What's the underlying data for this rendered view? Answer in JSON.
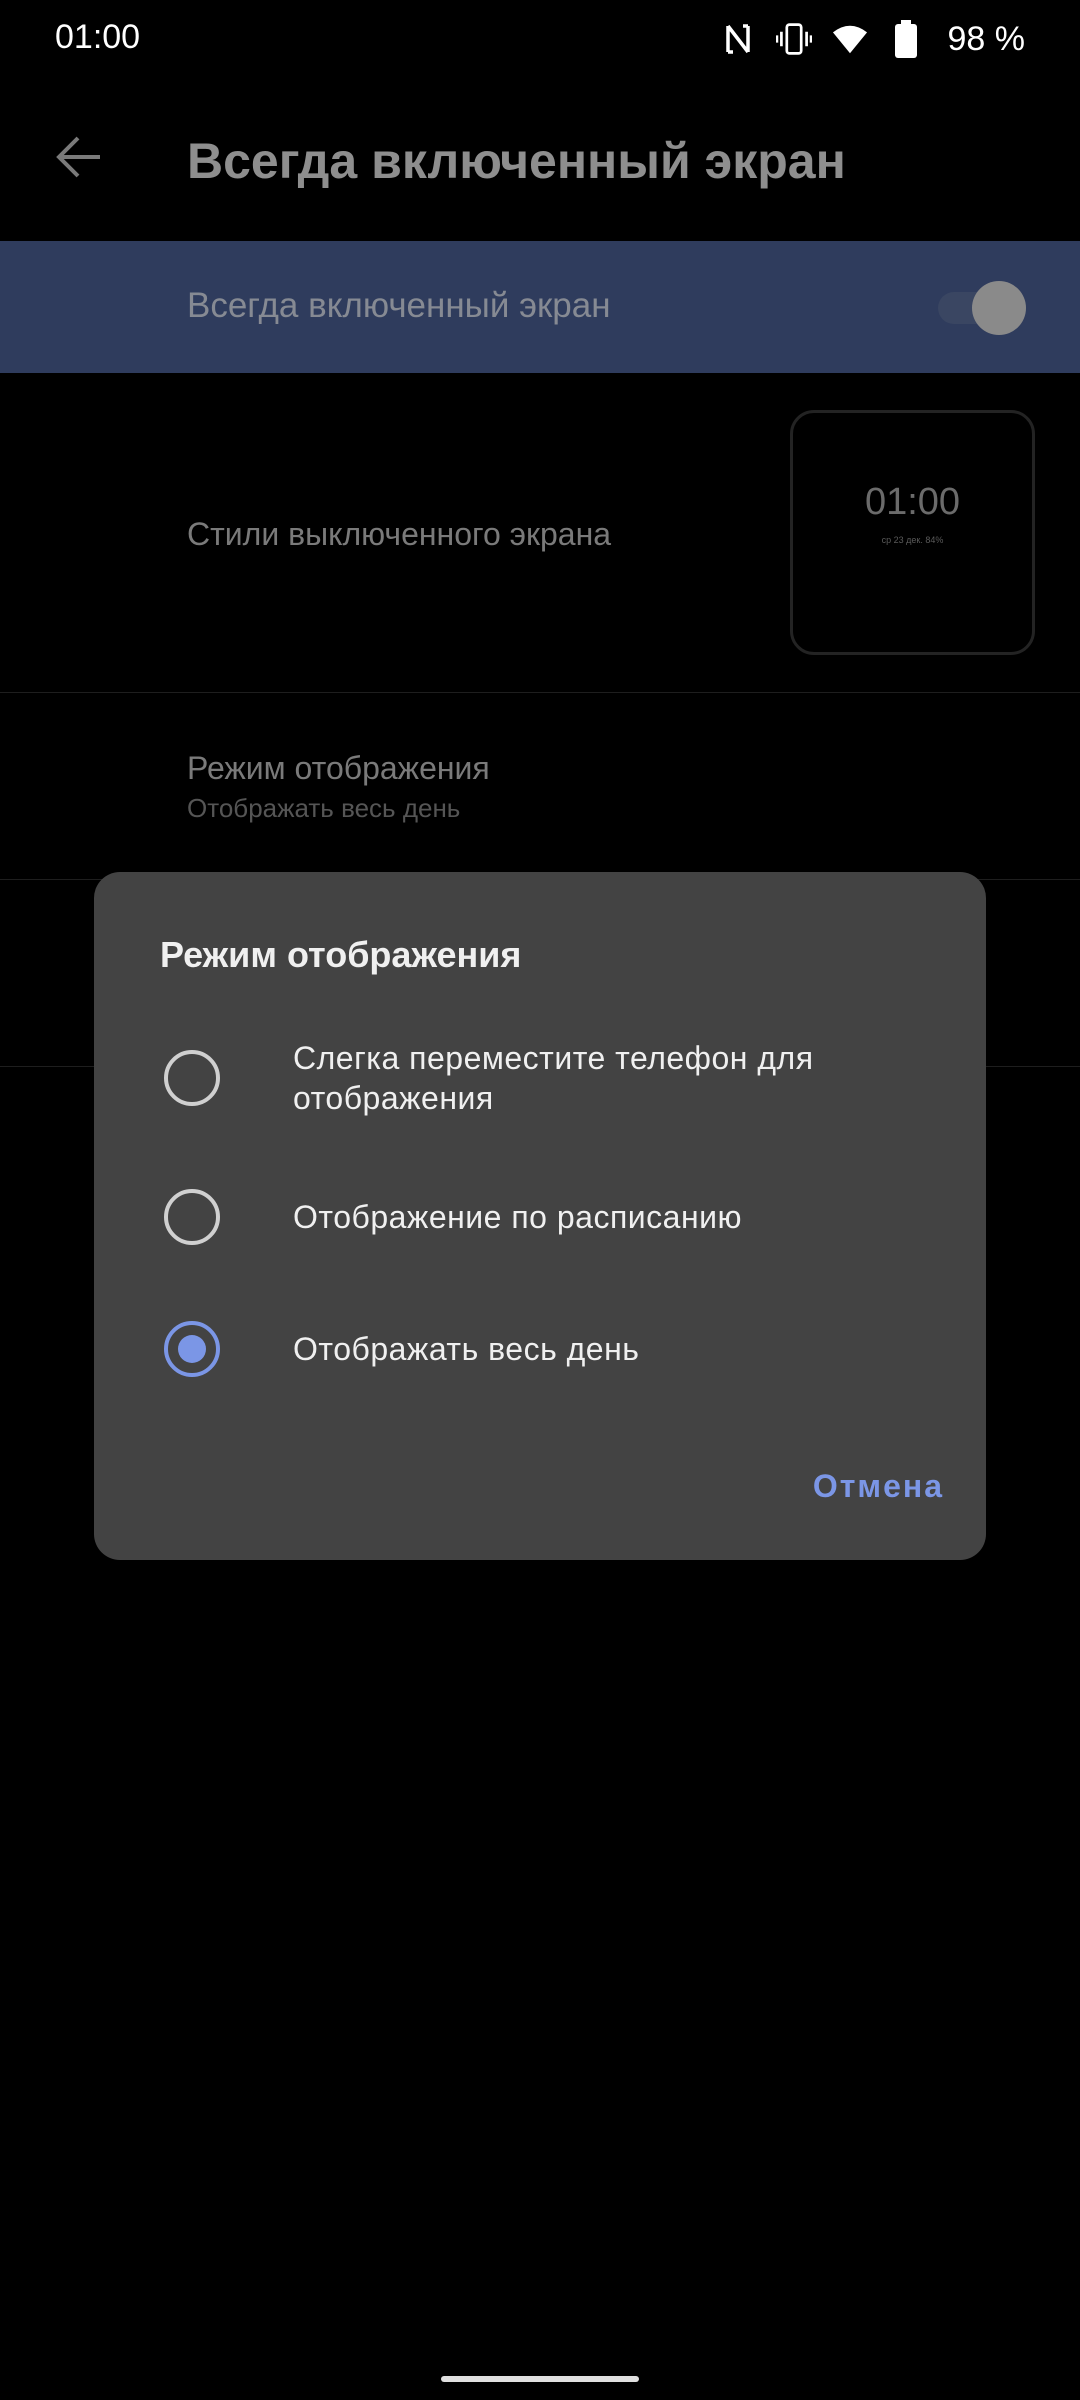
{
  "status_bar": {
    "time": "01:00",
    "battery_percent": "98 %",
    "icons": [
      "nfc-icon",
      "vibrate-icon",
      "wifi-icon",
      "battery-icon"
    ]
  },
  "header": {
    "title": "Всегда включенный экран",
    "back_icon": "arrow-back-icon"
  },
  "toggle_row": {
    "label": "Всегда включенный экран",
    "enabled": true
  },
  "styles_row": {
    "label": "Стили выключенного экрана",
    "preview_time": "01:00",
    "preview_date": "ср 23 дек. 84%"
  },
  "mode_row": {
    "title": "Режим отображения",
    "subtitle": "Отображать весь день"
  },
  "dialog": {
    "title": "Режим отображения",
    "options": [
      {
        "label_line1": "Слегка переместите телефон для",
        "label_line2": "отображения",
        "selected": false
      },
      {
        "label": "Отображение по расписанию",
        "selected": false
      },
      {
        "label": "Отображать весь день",
        "selected": true
      }
    ],
    "cancel_label": "Отмена"
  },
  "colors": {
    "accent": "#7b96e6",
    "dialog_bg": "#434343",
    "toggle_row_bg": "#2f3c5d"
  }
}
